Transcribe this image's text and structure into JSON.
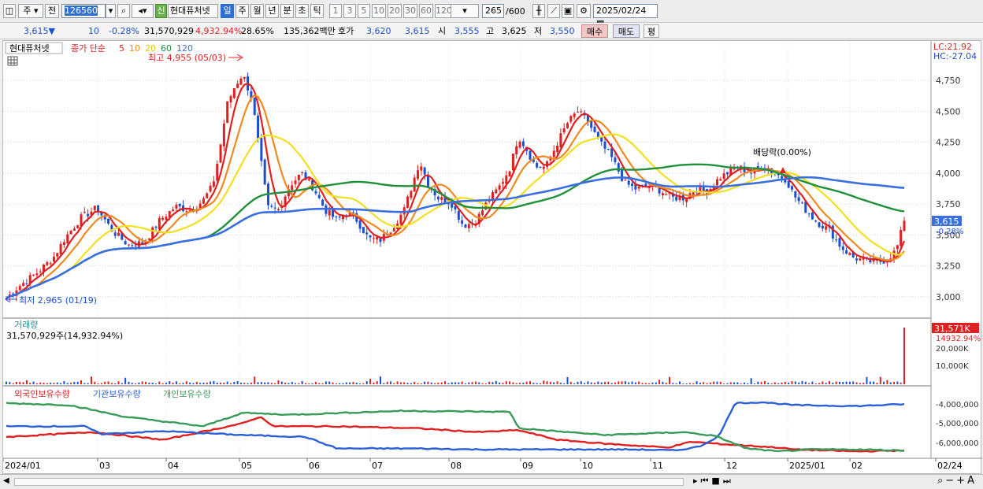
{
  "toolbar": {
    "market": "주",
    "mode": "전",
    "code": "126560",
    "new_badge": "신",
    "stock_name": "현대퓨처넷",
    "periods": [
      "일",
      "주",
      "월",
      "년",
      "분",
      "초",
      "틱"
    ],
    "minutes": [
      "1",
      "3",
      "5",
      "10",
      "20",
      "30",
      "60",
      "120"
    ],
    "count": "265",
    "count_total": "/600",
    "date": "2025/02/24"
  },
  "quote": {
    "price": "3,615",
    "arrow": "▼",
    "change": "10",
    "change_pct": "-0.28%",
    "volume": "31,570,929",
    "volume_ratio": "4,932.94%",
    "turnover": "28.65%",
    "amount": "135,362백만",
    "ask_label": "호가",
    "ask": "3,620",
    "bid": "3,615",
    "open_label": "시",
    "open": "3,555",
    "high_label": "고",
    "high": "3,625",
    "low_label": "저",
    "low": "3,550",
    "buy_btn": "매수",
    "sell_btn": "매도",
    "eval_btn": "평"
  },
  "legend": {
    "name": "현대퓨처넷",
    "ma_label": "종가 단순",
    "ma_periods": [
      "5",
      "10",
      "20",
      "60",
      "120"
    ],
    "lc": "LC:21.92",
    "hc": "HC:-27.04"
  },
  "annotations": {
    "high": "최고 4,955 (05/03)",
    "low": "최저 2,965 (01/19)",
    "dividend": "배당락(0.00%)"
  },
  "price_axis": [
    "4,750",
    "4,500",
    "4,250",
    "4,000",
    "3,750",
    "3,500",
    "3,250",
    "3,000"
  ],
  "price_tag": "3,615",
  "price_tag_pct": "-0.28%",
  "volume_panel": {
    "title": "거래량",
    "value": "31,570,929주(14,932.94%)",
    "tag": "31,571K",
    "tag_pct": "14932.94%",
    "axis": [
      "20,000K",
      "10,000K"
    ]
  },
  "holding_panel": {
    "series_names": [
      "외국인보유수량",
      "기관보유수량",
      "개인보유수량"
    ],
    "axis": [
      "-4,000,000",
      "-5,000,000",
      "-6,000,000"
    ]
  },
  "x_axis": [
    "2024/01",
    "03",
    "04",
    "05",
    "06",
    "07",
    "08",
    "09",
    "10",
    "11",
    "12",
    "2025/01",
    "02",
    "02/24"
  ],
  "colors": {
    "up": "#e02020",
    "down": "#1a4fd0",
    "ma5": "#e02020",
    "ma10": "#f08a20",
    "ma20": "#f2e020",
    "ma60": "#20903a",
    "ma120": "#3a6fe0",
    "foreign": "#e02020",
    "inst": "#2a5fd8",
    "indiv": "#3a9a5a"
  }
}
